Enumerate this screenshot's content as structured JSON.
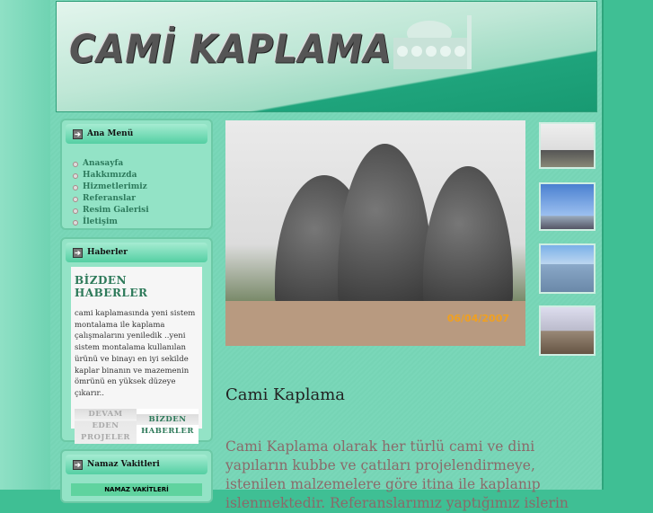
{
  "header": {
    "logo_text": "CAMİ KAPLAMA"
  },
  "ana_menu": {
    "title": "Ana Menü",
    "items": [
      "Anasayfa",
      "Hakkımızda",
      "Hizmetlerimiz",
      "Referanslar",
      "Resim Galerisi",
      "İletişim"
    ]
  },
  "haberler": {
    "title": "Haberler",
    "news_title": "BİZDEN HABERLER",
    "news_text": "cami kaplamasında yeni sistem montalama ile kaplama çalışmalarını yeniledik ..yeni sistem montalama kullanılan ürünü ve binayı en iyi sekilde kaplar binanın ve mazemenin ömrünü en yüksek düzeye çıkarır..",
    "tabs": [
      "DEVAM EDEN PROJELER",
      "BİZDEN HABERLER"
    ]
  },
  "namaz": {
    "title": "Namaz Vakitleri",
    "box_label": "NAMAZ VAKİTLERİ"
  },
  "main": {
    "photo_date": "06/04/2007",
    "title": "Cami Kaplama",
    "text": "Cami Kaplama olarak her türlü cami ve dini yapıların kubbe ve çatıları projelendirmeye, istenilen malzemelere göre itina ile kaplanıp islenmektedir. Referanslarımız yaptığımız islerin"
  }
}
